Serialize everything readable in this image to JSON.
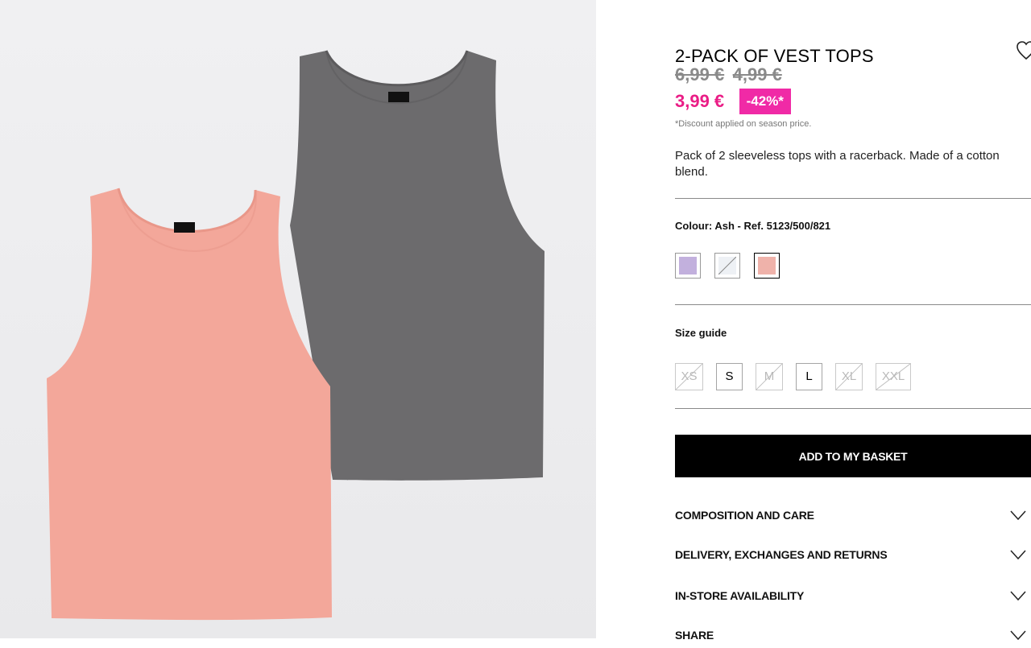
{
  "product": {
    "title": "2-PACK OF VEST TOPS",
    "old_prices": [
      "6,99 €",
      "4,99 €"
    ],
    "current_price": "3,99 €",
    "discount_badge": "-42%*",
    "discount_note": "*Discount applied on season price.",
    "description": "Pack of 2 sleeveless tops with a racerback. Made of a cotton blend."
  },
  "colour": {
    "label": "Colour: Ash - Ref. 5123/500/821",
    "swatches": [
      {
        "name": "lilac",
        "color": "#c2b0dd",
        "selected": false
      },
      {
        "name": "white",
        "color": "#eef1f5",
        "selected": false,
        "unavailable": true
      },
      {
        "name": "pink",
        "color": "#efb2aa",
        "selected": true
      }
    ]
  },
  "sizes": {
    "guide_label": "Size guide",
    "options": [
      {
        "label": "XS",
        "available": false
      },
      {
        "label": "S",
        "available": true
      },
      {
        "label": "M",
        "available": false
      },
      {
        "label": "L",
        "available": true
      },
      {
        "label": "XL",
        "available": false
      },
      {
        "label": "XXL",
        "available": false
      }
    ]
  },
  "actions": {
    "add_to_basket": "ADD TO MY BASKET"
  },
  "accordions": [
    {
      "label": "COMPOSITION AND CARE",
      "icon": "chevron-down-icon"
    },
    {
      "label": "DELIVERY, EXCHANGES AND RETURNS",
      "icon": "chevron-down-icon"
    },
    {
      "label": "IN-STORE AVAILABILITY",
      "icon": "chevron-down-icon"
    },
    {
      "label": "SHARE",
      "icon": "chevron-down-icon"
    }
  ],
  "colors": {
    "sale_pink": "#ea1d86",
    "badge_pink": "#f02aa6",
    "old_price_grey": "#8a8a8a",
    "button_black": "#000000"
  },
  "icons": {
    "wishlist": "heart-icon"
  }
}
